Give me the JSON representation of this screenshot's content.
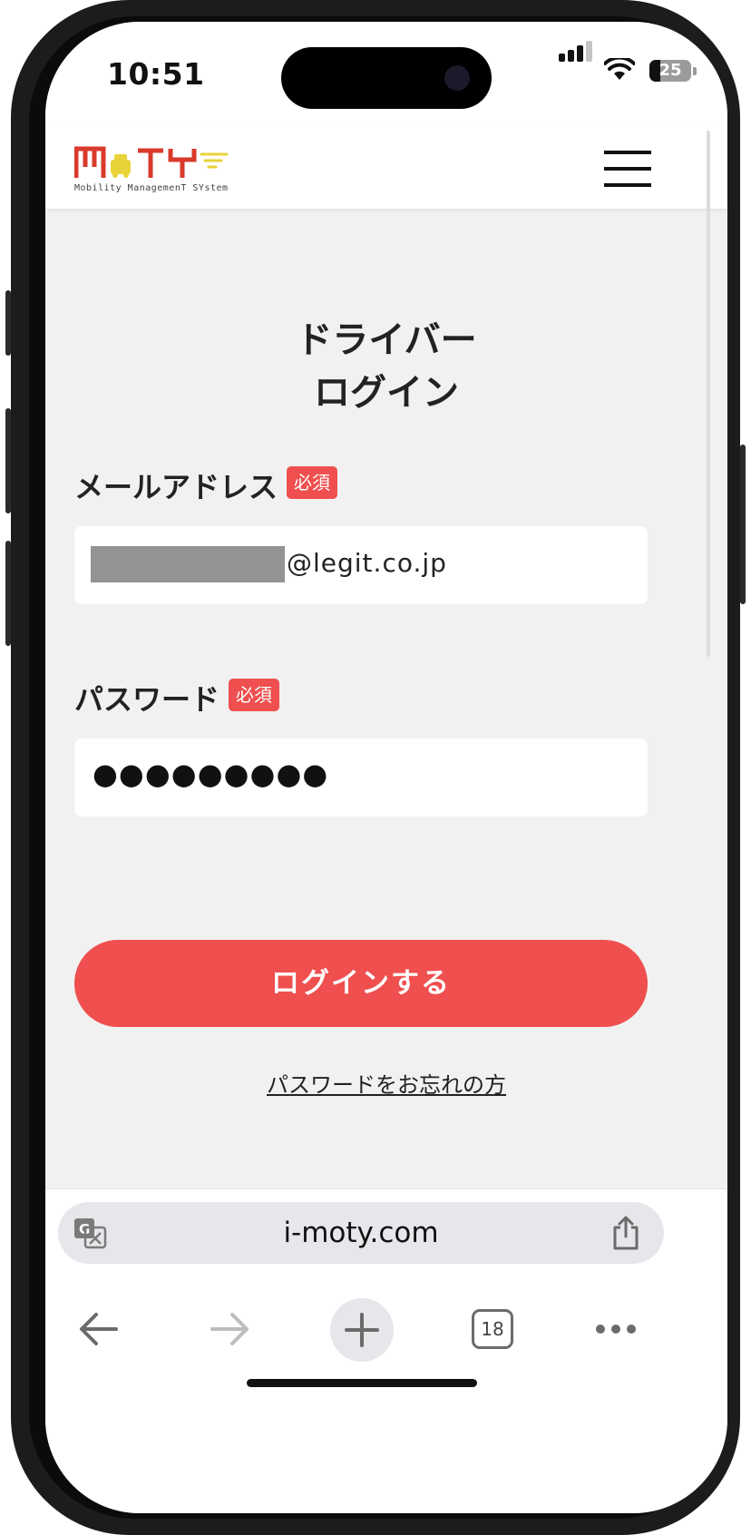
{
  "status_bar": {
    "time": "10:51",
    "battery_level": "25",
    "battery_fraction": 0.25,
    "icons": [
      "signal-icon",
      "wifi-icon",
      "battery-icon"
    ]
  },
  "header": {
    "logo_text": "MoTY",
    "logo_subtitle": "Mobility ManagemenT SYstem",
    "menu_icon": "hamburger-menu-icon"
  },
  "page": {
    "title_line1": "ドライバー",
    "title_line2": "ログイン"
  },
  "form": {
    "email": {
      "label": "メールアドレス",
      "required_badge": "必須",
      "value_visible": "@legit.co.jp"
    },
    "password": {
      "label": "パスワード",
      "required_badge": "必須",
      "masked_value": "●●●●●●●●●"
    },
    "submit_label": "ログインする",
    "forgot_link": "パスワードをお忘れの方"
  },
  "browser": {
    "url": "i-moty.com",
    "tab_count": "18",
    "icons": [
      "translate-icon",
      "share-icon",
      "back-arrow-icon",
      "forward-arrow-icon",
      "new-tab-plus-icon",
      "tabs-icon",
      "more-icon"
    ]
  },
  "colors": {
    "accent": "#ef4f4f",
    "logo_red": "#d93a2b",
    "logo_yellow": "#e8d33a",
    "background": "#f1f1f1"
  }
}
